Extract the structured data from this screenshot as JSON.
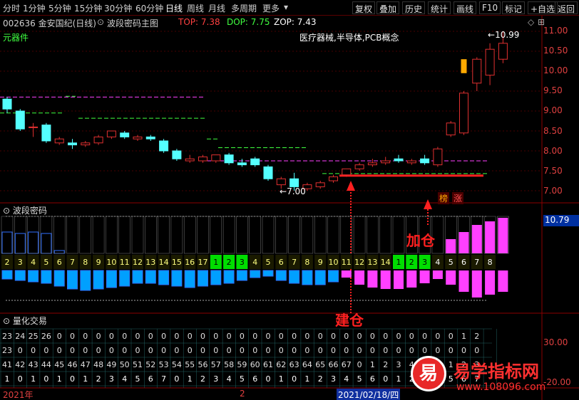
{
  "toolbar": {
    "period_tabs": [
      "分时",
      "1分钟",
      "5分钟",
      "15分钟",
      "30分钟",
      "60分钟",
      "日线",
      "周线",
      "月线",
      "多周期",
      "更多"
    ],
    "active_tab": "日线",
    "buttons": [
      "复权",
      "叠加",
      "历史",
      "统计",
      "画线",
      "F10",
      "标记",
      "+自选",
      "返回"
    ]
  },
  "chart_header": {
    "stock_code_name": "002636 金安国纪(日线)",
    "indicator_name": "波段密码主图",
    "top_label": "TOP: 7.38",
    "dop_label": "DOP: 7.75",
    "zop_label": "ZOP: 7.43",
    "concept_text": "医疗器械,半导体,PCB概念",
    "sector_text": "元器件"
  },
  "price_axis": [
    "11.00",
    "10.50",
    "10.00",
    "9.50",
    "9.00",
    "8.50",
    "8.00",
    "7.50",
    "7.00"
  ],
  "price_annotations": {
    "high": "10.99",
    "low": "7.00"
  },
  "badges": {
    "bang": "榜",
    "zhang": "涨"
  },
  "panel2": {
    "title": "波段密码",
    "value_box": "10.79",
    "count_row": [
      "2",
      "3",
      "4",
      "5",
      "6",
      "7",
      "8",
      "9",
      "10",
      "11",
      "12",
      "13",
      "14",
      "15",
      "16",
      "17",
      "1",
      "2",
      "3",
      "4",
      "5",
      "6",
      "7",
      "8",
      "9",
      "10",
      "11",
      "12",
      "13",
      "14",
      "1",
      "2",
      "3",
      "4",
      "5",
      "6",
      "7",
      "8"
    ],
    "annotation_jiacang": "加仓",
    "annotation_jiancang": "建仓"
  },
  "panel3": {
    "title": "量化交易",
    "axis_label": "30.00",
    "axis_label2": "-20.00",
    "rows": [
      [
        "23",
        "24",
        "25",
        "26",
        "0",
        "0",
        "0",
        "0",
        "0",
        "0",
        "0",
        "0",
        "0",
        "0",
        "0",
        "0",
        "0",
        "0",
        "0",
        "0",
        "0",
        "0",
        "0",
        "0",
        "0",
        "0",
        "0",
        "0",
        "0",
        "0",
        "0",
        "0",
        "0",
        "0",
        "0",
        "1",
        "2"
      ],
      [
        "23",
        "0",
        "0",
        "0",
        "0",
        "0",
        "0",
        "0",
        "0",
        "0",
        "0",
        "0",
        "0",
        "0",
        "0",
        "0",
        "0",
        "0",
        "0",
        "0",
        "0",
        "0",
        "0",
        "0",
        "0",
        "0",
        "0",
        "0",
        "0",
        "0",
        "0",
        "0",
        "0",
        "0",
        "0",
        "0",
        "0"
      ],
      [
        "41",
        "42",
        "43",
        "44",
        "45",
        "46",
        "47",
        "48",
        "49",
        "50",
        "51",
        "52",
        "53",
        "54",
        "55",
        "56",
        "57",
        "58",
        "59",
        "60",
        "61",
        "62",
        "63",
        "64",
        "65",
        "66",
        "67",
        "0",
        "1",
        "2",
        "3",
        "4",
        "5",
        "6",
        "1",
        "2",
        "3"
      ],
      [
        "1",
        "0",
        "1",
        "0",
        "1",
        "0",
        "1",
        "2",
        "3",
        "4",
        "5",
        "6",
        "7",
        "0",
        "1",
        "2",
        "3",
        "4",
        "5",
        "6",
        "0",
        "1",
        "0",
        "1",
        "2",
        "3",
        "4",
        "5",
        "6",
        "0",
        "1",
        "2",
        "3",
        "4",
        "5",
        "6",
        "7"
      ]
    ],
    "date_left": "2021年",
    "date_mid": "2",
    "date_cursor": "2021/02/18/四"
  },
  "watermark": {
    "logo_char": "易",
    "site_name": "易学指标网",
    "url": "www.108096.com"
  },
  "colors": {
    "up": "#e03030",
    "down": "#54ffff",
    "magenta": "#ff40ff",
    "yellow": "#ffff00",
    "green": "#00ff00"
  },
  "candles": [
    {
      "o": 9.3,
      "c": 9.05,
      "h": 9.35,
      "l": 8.95
    },
    {
      "o": 9.0,
      "c": 8.55,
      "h": 9.05,
      "l": 8.5
    },
    {
      "o": 8.6,
      "c": 8.6,
      "h": 8.7,
      "l": 8.35
    },
    {
      "o": 8.65,
      "c": 8.25,
      "h": 8.7,
      "l": 8.2
    },
    {
      "o": 8.2,
      "c": 8.3,
      "h": 8.35,
      "l": 8.15
    },
    {
      "o": 8.2,
      "c": 8.15,
      "h": 8.3,
      "l": 8.05
    },
    {
      "o": 8.15,
      "c": 8.2,
      "h": 8.25,
      "l": 8.1
    },
    {
      "o": 8.2,
      "c": 8.35,
      "h": 8.4,
      "l": 8.15
    },
    {
      "o": 8.35,
      "c": 8.5,
      "h": 8.5,
      "l": 8.3
    },
    {
      "o": 8.45,
      "c": 8.35,
      "h": 8.5,
      "l": 8.3
    },
    {
      "o": 8.3,
      "c": 8.35,
      "h": 8.4,
      "l": 8.25
    },
    {
      "o": 8.35,
      "c": 8.3,
      "h": 8.4,
      "l": 8.25
    },
    {
      "o": 8.25,
      "c": 8.0,
      "h": 8.3,
      "l": 7.95
    },
    {
      "o": 8.0,
      "c": 7.8,
      "h": 8.05,
      "l": 7.75
    },
    {
      "o": 7.75,
      "c": 7.8,
      "h": 7.9,
      "l": 7.7
    },
    {
      "o": 7.75,
      "c": 7.85,
      "h": 7.9,
      "l": 7.7
    },
    {
      "o": 7.75,
      "c": 7.9,
      "h": 7.9,
      "l": 7.7
    },
    {
      "o": 7.9,
      "c": 7.7,
      "h": 7.95,
      "l": 7.65
    },
    {
      "o": 7.7,
      "c": 7.65,
      "h": 7.8,
      "l": 7.6
    },
    {
      "o": 7.8,
      "c": 7.65,
      "h": 7.85,
      "l": 7.6
    },
    {
      "o": 7.6,
      "c": 7.3,
      "h": 7.65,
      "l": 7.25
    },
    {
      "o": 7.15,
      "c": 7.3,
      "h": 7.35,
      "l": 7.05
    },
    {
      "o": 7.3,
      "c": 7.1,
      "h": 7.45,
      "l": 7.0
    },
    {
      "o": 7.05,
      "c": 7.15,
      "h": 7.2,
      "l": 7.0
    },
    {
      "o": 7.1,
      "c": 7.2,
      "h": 7.25,
      "l": 7.05
    },
    {
      "o": 7.25,
      "c": 7.35,
      "h": 7.4,
      "l": 7.2
    },
    {
      "o": 7.4,
      "c": 7.55,
      "h": 7.55,
      "l": 7.35
    },
    {
      "o": 7.55,
      "c": 7.65,
      "h": 7.7,
      "l": 7.5
    },
    {
      "o": 7.65,
      "c": 7.7,
      "h": 7.8,
      "l": 7.6
    },
    {
      "o": 7.7,
      "c": 7.75,
      "h": 7.85,
      "l": 7.65
    },
    {
      "o": 7.8,
      "c": 7.75,
      "h": 7.9,
      "l": 7.7
    },
    {
      "o": 7.7,
      "c": 7.75,
      "h": 7.8,
      "l": 7.65
    },
    {
      "o": 7.8,
      "c": 7.7,
      "h": 7.9,
      "l": 7.65
    },
    {
      "o": 7.65,
      "c": 8.05,
      "h": 8.1,
      "l": 7.6
    },
    {
      "o": 8.4,
      "c": 8.7,
      "h": 8.75,
      "l": 8.35
    },
    {
      "o": 8.45,
      "c": 9.45,
      "h": 9.5,
      "l": 8.4
    },
    {
      "o": 9.7,
      "c": 10.3,
      "h": 10.35,
      "l": 9.5
    },
    {
      "o": 9.9,
      "c": 10.55,
      "h": 10.7,
      "l": 9.65
    },
    {
      "o": 10.3,
      "c": 10.7,
      "h": 10.99,
      "l": 10.2
    }
  ]
}
